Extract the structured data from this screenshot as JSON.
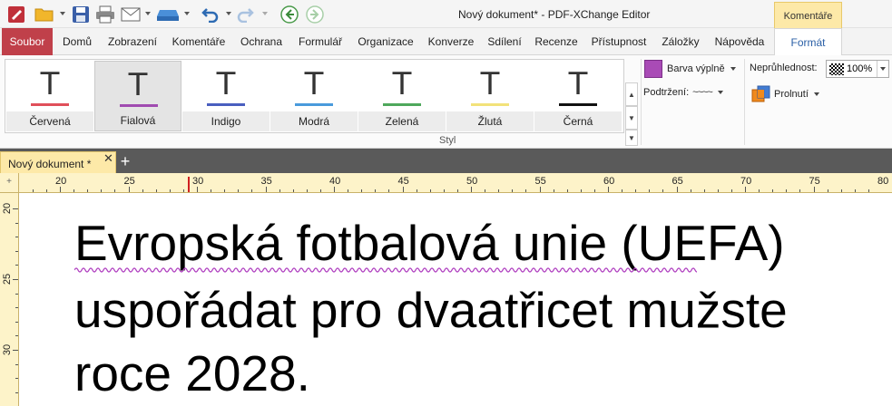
{
  "window": {
    "title": "Nový dokument* - PDF-XChange Editor",
    "context_tab": "Komentáře"
  },
  "menu_tabs": [
    {
      "label": "Soubor"
    },
    {
      "label": "Domů"
    },
    {
      "label": "Zobrazení"
    },
    {
      "label": "Komentáře"
    },
    {
      "label": "Ochrana"
    },
    {
      "label": "Formulář"
    },
    {
      "label": "Organizace"
    },
    {
      "label": "Konverze"
    },
    {
      "label": "Sdílení"
    },
    {
      "label": "Recenze"
    },
    {
      "label": "Přístupnost"
    },
    {
      "label": "Záložky"
    },
    {
      "label": "Nápověda"
    },
    {
      "label": "Formát"
    }
  ],
  "style_gallery": {
    "glyph": "T",
    "group_label": "Styl",
    "items": [
      {
        "label": "Červená",
        "color": "#e0505a"
      },
      {
        "label": "Fialová",
        "color": "#a04bb0"
      },
      {
        "label": "Indigo",
        "color": "#4a5fbf"
      },
      {
        "label": "Modrá",
        "color": "#4a9bdc"
      },
      {
        "label": "Zelená",
        "color": "#4fa85c"
      },
      {
        "label": "Žlutá",
        "color": "#f2e27a"
      },
      {
        "label": "Černá",
        "color": "#111111"
      }
    ]
  },
  "format_controls": {
    "fill_color_label": "Barva výplně",
    "fill_color": "#a94bb6",
    "underline_label": "Podtržení:",
    "underline_style": "~~~~",
    "opacity_label": "Neprůhlednost:",
    "opacity_value": "100%",
    "blend_label": "Prolnutí"
  },
  "document_tab": {
    "title": "Nový dokument *",
    "close_glyph": "✕",
    "add_glyph": "+"
  },
  "ruler": {
    "horizontal_labels": [
      "20",
      "25",
      "30",
      "35",
      "40",
      "45",
      "50",
      "55",
      "60",
      "65",
      "70",
      "75",
      "80"
    ],
    "vertical_labels": [
      "20",
      "25",
      "30"
    ],
    "corner_glyph": "+"
  },
  "document": {
    "lines": [
      "Evropská fotbalová unie (UEFA)",
      "uspořádat pro dvaatřicet mužste",
      "roce 2028."
    ]
  }
}
